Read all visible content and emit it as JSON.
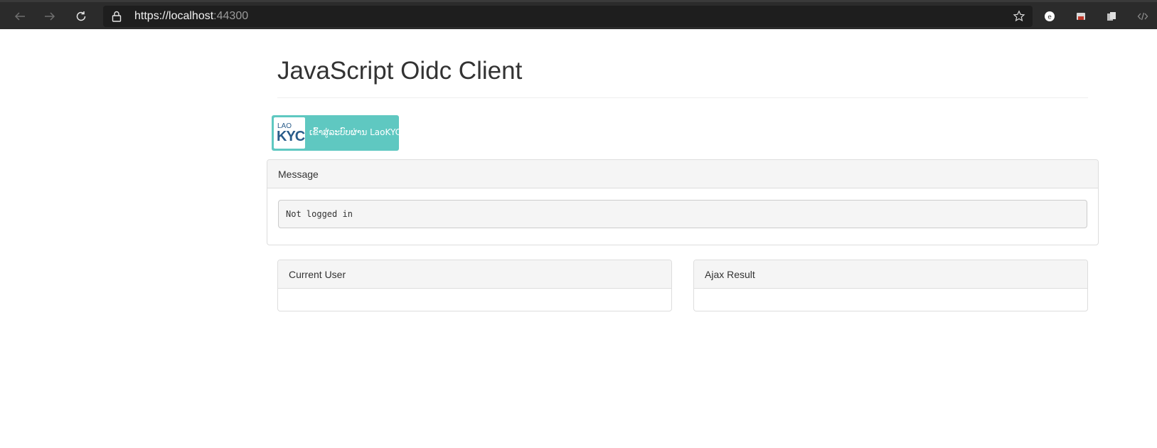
{
  "browser": {
    "url_main": "https://localhost",
    "url_port": ":44300",
    "icons": {
      "back": "back-arrow-icon",
      "forward": "forward-arrow-icon",
      "refresh": "refresh-icon",
      "lock": "lock-icon",
      "favorite": "star-icon"
    }
  },
  "page": {
    "title": "JavaScript Oidc Client",
    "login_button": {
      "logo_small": "LAO",
      "logo_big": "KYC",
      "label": "ເຂົ້າສູ່ລະບົບຜ່ານ LaoKYC",
      "color": "#5fc8c1"
    },
    "message_panel": {
      "heading": "Message",
      "content": "Not logged in"
    },
    "current_user_panel": {
      "heading": "Current User"
    },
    "ajax_result_panel": {
      "heading": "Ajax Result"
    }
  },
  "colors": {
    "accent": "#5fc8c1",
    "chrome_bg": "#2b2b2b",
    "panel_heading_bg": "#f5f5f5"
  }
}
